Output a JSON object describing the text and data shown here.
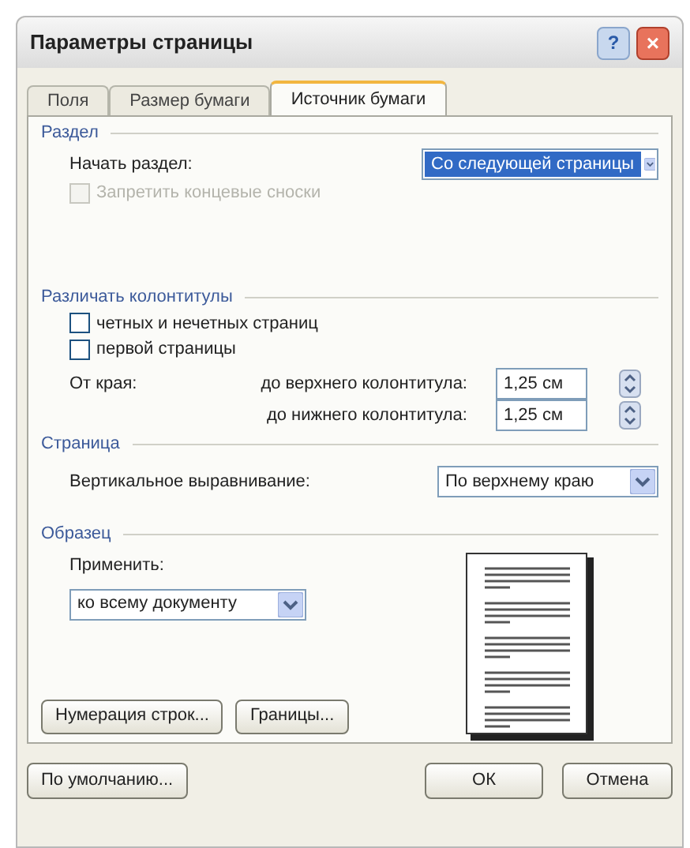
{
  "window": {
    "title": "Параметры страницы",
    "help_button": "?",
    "close_button": "×"
  },
  "tabs": [
    {
      "label": "Поля",
      "selected": false
    },
    {
      "label": "Размер бумаги",
      "selected": false
    },
    {
      "label": "Источник бумаги",
      "selected": true
    }
  ],
  "section": {
    "title": "Раздел",
    "start_label": "Начать раздел:",
    "start_value": "Со следующей страницы",
    "suppress_endnotes": {
      "label": "Запретить концевые сноски",
      "checked": false,
      "disabled": true
    }
  },
  "headers_footers": {
    "title": "Различать колонтитулы",
    "options": [
      {
        "label": "четных и нечетных страниц",
        "checked": false
      },
      {
        "label": "первой страницы",
        "checked": false
      }
    ],
    "from_edge_label": "От края:",
    "fields": [
      {
        "label": "до верхнего колонтитула:",
        "value": "1,25 см"
      },
      {
        "label": "до нижнего колонтитула:",
        "value": "1,25 см"
      }
    ]
  },
  "page": {
    "title": "Страница",
    "valign_label": "Вертикальное выравнивание:",
    "valign_value": "По верхнему краю"
  },
  "preview": {
    "title": "Образец",
    "apply_label": "Применить:",
    "apply_value": "ко всему документу"
  },
  "panel_buttons": [
    "Нумерация строк...",
    "Границы..."
  ],
  "footer": {
    "default_button": "По умолчанию...",
    "ok_button": "ОК",
    "cancel_button": "Отмена"
  }
}
